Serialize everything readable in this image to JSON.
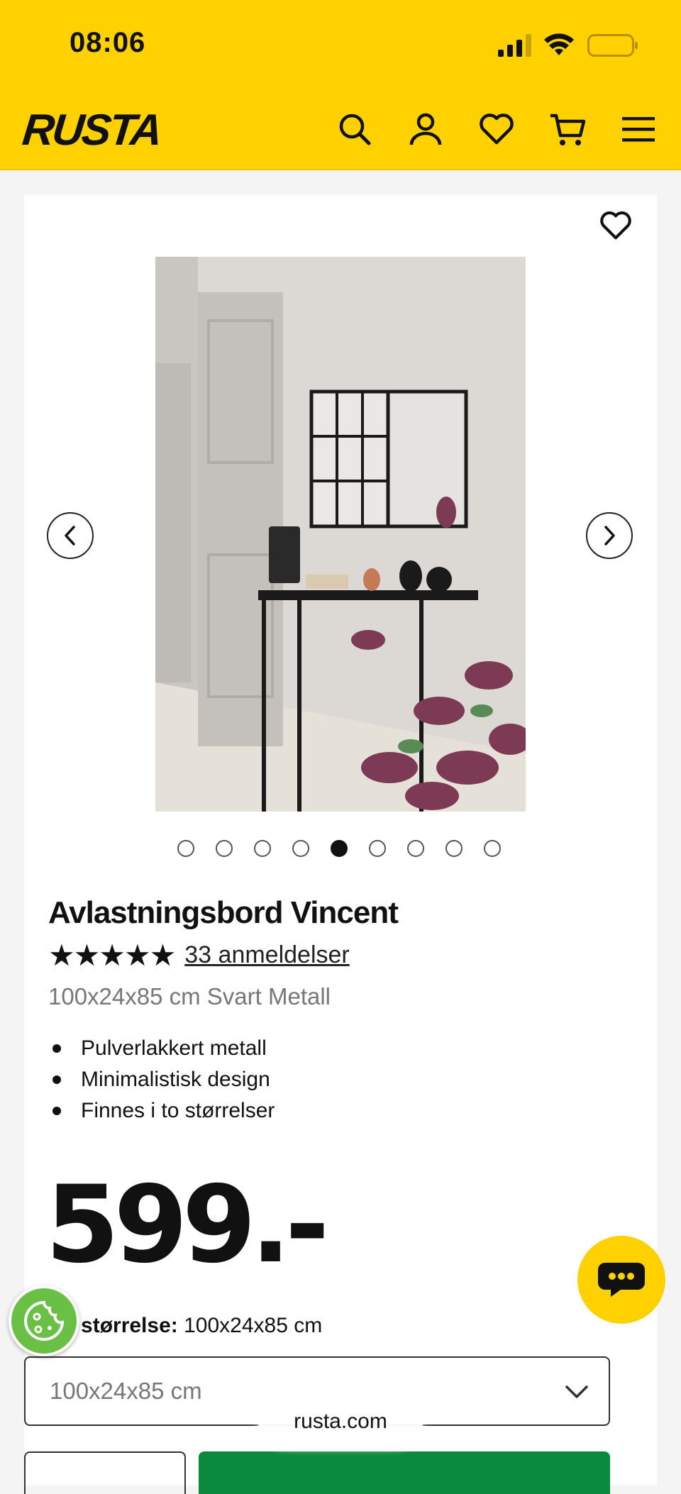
{
  "status_bar": {
    "time": "08:06"
  },
  "header": {
    "logo": "RUSTA"
  },
  "product": {
    "title": "Avlastningsbord Vincent",
    "stars": "★★★★★",
    "reviews_link": "33 anmeldelser",
    "variant": "100x24x85 cm Svart Metall",
    "features": [
      "Pulverlakkert metall",
      "Minimalistisk design",
      "Finnes i to størrelser"
    ],
    "price": "599.-",
    "image_count": 9,
    "active_image_index": 4
  },
  "size": {
    "label": "Valgt størrelse:",
    "value": "100x24x85 cm",
    "select_value": "100x24x85 cm"
  },
  "browser": {
    "url": "rusta.com"
  },
  "colors": {
    "brand_yellow": "#ffd100",
    "buy_green": "#0a8a3c",
    "cookie_green": "#6abf45"
  }
}
